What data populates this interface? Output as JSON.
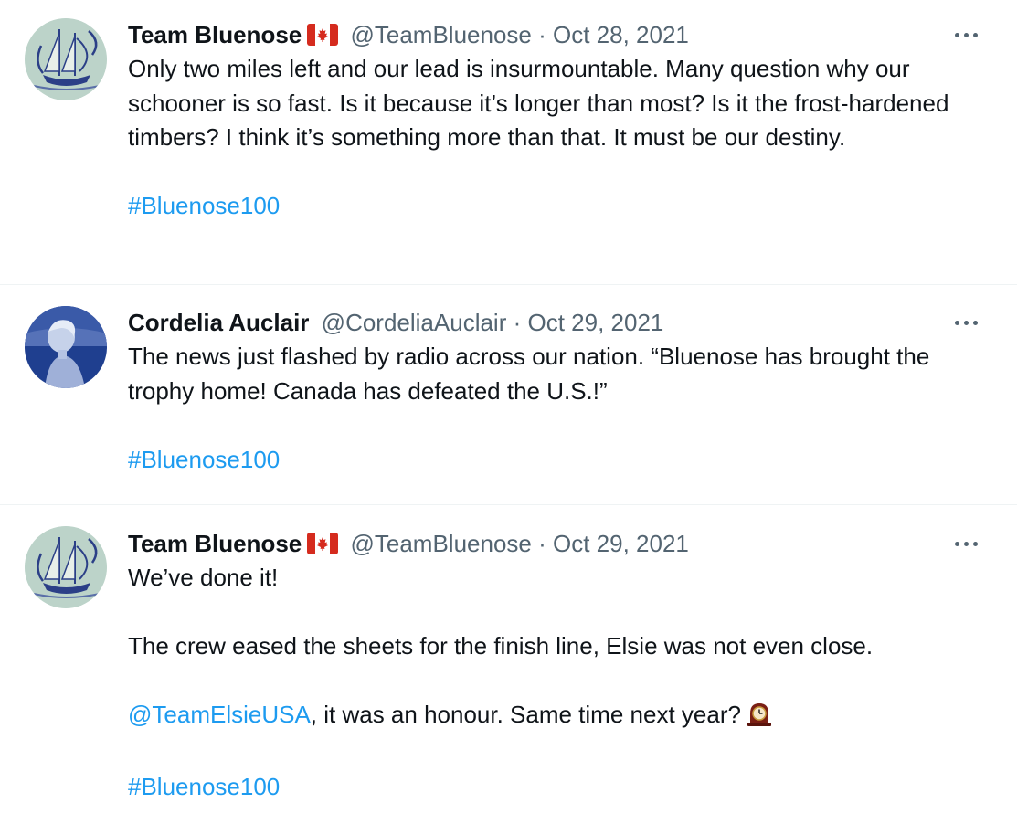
{
  "tweets": [
    {
      "author_name": "Team Bluenose",
      "author_flag": "canada-flag-icon",
      "handle": "@TeamBluenose",
      "separator": "·",
      "date": "Oct 28, 2021",
      "text": "Only two miles left and our lead is insurmountable. Many question why our schooner is so fast. Is it because it’s longer than most? Is it the frost-hardened timbers? I think it’s something more than that. It must be our destiny.",
      "hashtag": "#Bluenose100"
    },
    {
      "author_name": "Cordelia Auclair",
      "handle": "@CordeliaAuclair",
      "separator": "·",
      "date": "Oct 29, 2021",
      "text": "The news just flashed by radio across our nation. “Bluenose has brought the trophy home! Canada has defeated the U.S.!”",
      "hashtag": "#Bluenose100"
    },
    {
      "author_name": "Team Bluenose",
      "author_flag": "canada-flag-icon",
      "handle": "@TeamBluenose",
      "separator": "·",
      "date": "Oct 29, 2021",
      "line1": "We’ve done it!",
      "line2": "The crew eased the sheets for the finish line, Elsie was not even close.",
      "mention": "@TeamElsieUSA",
      "line3_rest": ", it was an honour. Same time next year?",
      "line3_emoji": "mantelpiece-clock-icon",
      "hashtag": "#Bluenose100"
    }
  ],
  "colors": {
    "link": "#1d9bf0",
    "secondary_text": "#536471",
    "primary_text": "#0f1419",
    "divider": "#eff3f4"
  }
}
